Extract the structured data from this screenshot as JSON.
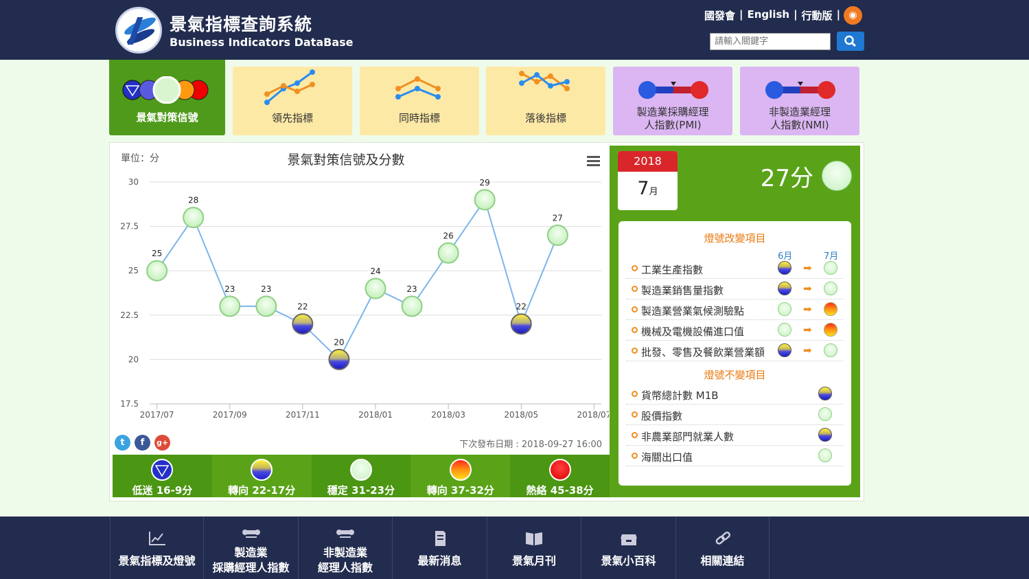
{
  "header": {
    "title": "景氣指標查詢系統",
    "subtitle": "Business Indicators DataBase",
    "links": [
      "國發會",
      "|",
      "English",
      "|",
      "行動版",
      "|"
    ],
    "search_placeholder": "請輸入關鍵字"
  },
  "tabs": [
    {
      "label": "景氣對策信號"
    },
    {
      "label": "領先指標"
    },
    {
      "label": "同時指標"
    },
    {
      "label": "落後指標"
    },
    {
      "label1": "製造業採購經理",
      "label2": "人指數(PMI)"
    },
    {
      "label1": "非製造業經理",
      "label2": "人指數(NMI)"
    }
  ],
  "chart": {
    "unit": "單位：分",
    "next_release": "下次發布日期 : 2018-09-27 16:00"
  },
  "chart_data": {
    "type": "line",
    "title": "景氣對策信號及分數",
    "ylabel": "單位：分",
    "ylim": [
      17.5,
      30
    ],
    "yticks": [
      "30",
      "27.5",
      "25",
      "22.5",
      "20",
      "17.5"
    ],
    "xticks": [
      "2017/07",
      "2017/09",
      "2017/11",
      "2018/01",
      "2018/03",
      "2018/05",
      "2018/07"
    ],
    "categories": [
      "2017/07",
      "2017/08",
      "2017/09",
      "2017/10",
      "2017/11",
      "2017/12",
      "2018/01",
      "2018/02",
      "2018/03",
      "2018/04",
      "2018/05",
      "2018/06",
      "2018/07"
    ],
    "values": [
      25,
      28,
      23,
      23,
      22,
      20,
      24,
      23,
      26,
      29,
      22,
      27
    ],
    "signals": [
      "green",
      "green",
      "green",
      "green",
      "yellow-blue",
      "yellow-blue",
      "green",
      "green",
      "green",
      "green",
      "yellow-blue",
      "green"
    ],
    "grid": true
  },
  "legend": [
    {
      "label": "低迷 16-9分",
      "color": "#2330c8"
    },
    {
      "label": "轉向 22-17分",
      "color": "#5a5ae0"
    },
    {
      "label": "穩定 31-23分",
      "color": "#d8f5d0"
    },
    {
      "label": "轉向 37-32分",
      "color": "#ff9a10"
    },
    {
      "label": "熱絡 45-38分",
      "color": "#ee0000"
    }
  ],
  "current": {
    "year": "2018",
    "month": "7",
    "month_suffix": "月",
    "score": "27分"
  },
  "changed": {
    "title": "燈號改變項目",
    "col1": "6月",
    "col2": "7月",
    "items": [
      {
        "name": "工業生產指數",
        "from": "yellow-blue",
        "to": "green"
      },
      {
        "name": "製造業銷售量指數",
        "from": "yellow-blue",
        "to": "green"
      },
      {
        "name": "製造業營業氣候測驗點",
        "from": "green",
        "to": "yellow-red"
      },
      {
        "name": "機械及電機設備進口值",
        "from": "green",
        "to": "yellow-red"
      },
      {
        "name": "批發、零售及餐飲業營業額",
        "from": "yellow-blue",
        "to": "green"
      }
    ]
  },
  "unchanged": {
    "title": "燈號不變項目",
    "items": [
      {
        "name": "貨幣總計數 M1B",
        "signal": "yellow-blue"
      },
      {
        "name": "股價指數",
        "signal": "green"
      },
      {
        "name": "非農業部門就業人數",
        "signal": "yellow-blue"
      },
      {
        "name": "海關出口值",
        "signal": "green"
      }
    ]
  },
  "bottom_nav": [
    {
      "label1": "",
      "label2": "景氣指標及燈號",
      "icon": "line-chart-icon"
    },
    {
      "label1": "製造業",
      "label2": "採購經理人指數",
      "icon": "gauge-icon"
    },
    {
      "label1": "非製造業",
      "label2": "經理人指數",
      "icon": "gauge-icon"
    },
    {
      "label1": "",
      "label2": "最新消息",
      "icon": "document-icon"
    },
    {
      "label1": "",
      "label2": "景氣月刊",
      "icon": "book-icon"
    },
    {
      "label1": "",
      "label2": "景氣小百科",
      "icon": "box-icon"
    },
    {
      "label1": "",
      "label2": "相關連結",
      "icon": "link-icon"
    }
  ]
}
